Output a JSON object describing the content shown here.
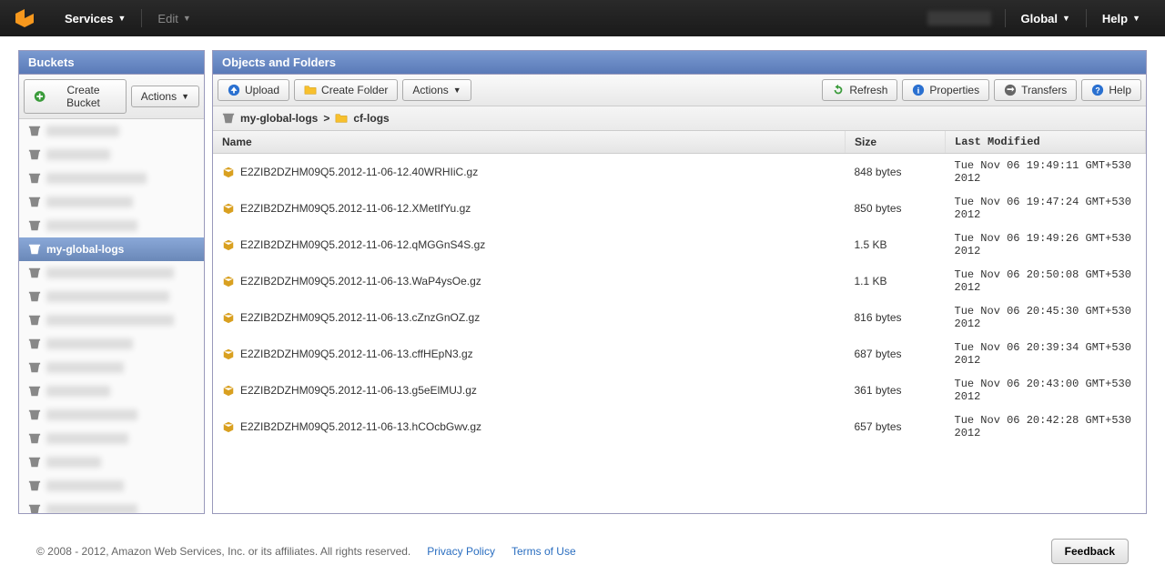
{
  "topnav": {
    "services": "Services",
    "edit": "Edit",
    "global": "Global",
    "help": "Help"
  },
  "buckets_panel": {
    "title": "Buckets",
    "create_bucket": "Create Bucket",
    "actions": "Actions",
    "selected_bucket": "my-global-logs"
  },
  "objects_panel": {
    "title": "Objects and Folders",
    "upload": "Upload",
    "create_folder": "Create Folder",
    "actions": "Actions",
    "refresh": "Refresh",
    "properties": "Properties",
    "transfers": "Transfers",
    "help": "Help",
    "breadcrumb_bucket": "my-global-logs",
    "breadcrumb_sep": ">",
    "breadcrumb_folder": "cf-logs",
    "columns": {
      "name": "Name",
      "size": "Size",
      "modified": "Last Modified"
    },
    "rows": [
      {
        "name": "E2ZIB2DZHM09Q5.2012-11-06-12.40WRHIiC.gz",
        "size": "848 bytes",
        "modified": "Tue Nov 06 19:49:11 GMT+530 2012"
      },
      {
        "name": "E2ZIB2DZHM09Q5.2012-11-06-12.XMetIfYu.gz",
        "size": "850 bytes",
        "modified": "Tue Nov 06 19:47:24 GMT+530 2012"
      },
      {
        "name": "E2ZIB2DZHM09Q5.2012-11-06-12.qMGGnS4S.gz",
        "size": "1.5 KB",
        "modified": "Tue Nov 06 19:49:26 GMT+530 2012"
      },
      {
        "name": "E2ZIB2DZHM09Q5.2012-11-06-13.WaP4ysOe.gz",
        "size": "1.1 KB",
        "modified": "Tue Nov 06 20:50:08 GMT+530 2012"
      },
      {
        "name": "E2ZIB2DZHM09Q5.2012-11-06-13.cZnzGnOZ.gz",
        "size": "816 bytes",
        "modified": "Tue Nov 06 20:45:30 GMT+530 2012"
      },
      {
        "name": "E2ZIB2DZHM09Q5.2012-11-06-13.cffHEpN3.gz",
        "size": "687 bytes",
        "modified": "Tue Nov 06 20:39:34 GMT+530 2012"
      },
      {
        "name": "E2ZIB2DZHM09Q5.2012-11-06-13.g5eElMUJ.gz",
        "size": "361 bytes",
        "modified": "Tue Nov 06 20:43:00 GMT+530 2012"
      },
      {
        "name": "E2ZIB2DZHM09Q5.2012-11-06-13.hCOcbGwv.gz",
        "size": "657 bytes",
        "modified": "Tue Nov 06 20:42:28 GMT+530 2012"
      }
    ]
  },
  "footer": {
    "copyright": "© 2008 - 2012, Amazon Web Services, Inc. or its affiliates. All rights reserved.",
    "privacy": "Privacy Policy",
    "terms": "Terms of Use",
    "feedback": "Feedback"
  }
}
